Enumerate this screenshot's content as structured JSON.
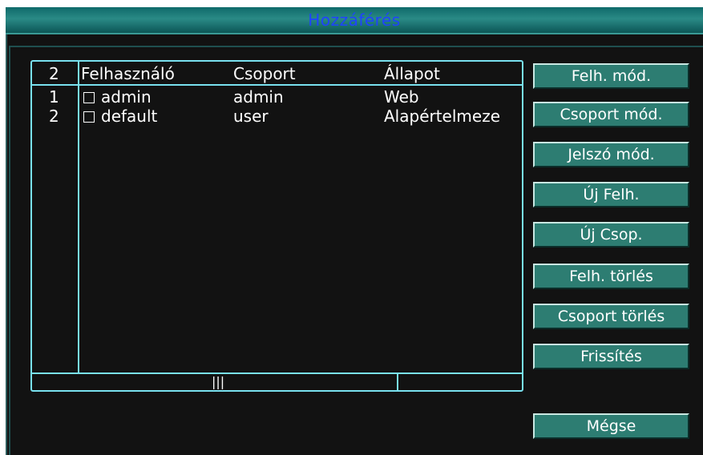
{
  "window": {
    "title": "Hozzáférés"
  },
  "table": {
    "count": "2",
    "headers": {
      "user": "Felhasználó",
      "group": "Csoport",
      "status": "Állapot"
    },
    "rows": [
      {
        "index": "1",
        "user": "admin",
        "group": "admin",
        "status": "Web"
      },
      {
        "index": "2",
        "user": "default",
        "group": "user",
        "status": "Alapértelmeze"
      }
    ],
    "scroll_grip": "|||"
  },
  "buttons": {
    "modify_user": "Felh. mód.",
    "modify_group": "Csoport mód.",
    "modify_password": "Jelszó mód.",
    "add_user": "Új Felh.",
    "add_group": "Új Csop.",
    "delete_user": "Felh. törlés",
    "delete_group": "Csoport törlés",
    "refresh": "Frissítés",
    "cancel": "Mégse"
  },
  "colors": {
    "title_text": "#1f43ff",
    "titlebar": "#2a8a86",
    "table_border": "#79e1ef",
    "button_bg": "#2d7d72",
    "background": "#121212"
  }
}
